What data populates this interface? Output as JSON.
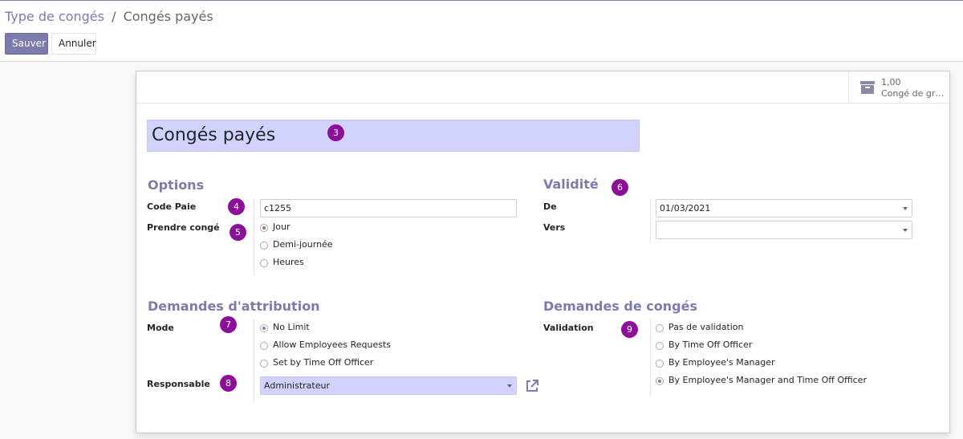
{
  "breadcrumb": {
    "parent": "Type de congés",
    "separator": "/",
    "current": "Congés payés"
  },
  "actions": {
    "save": "Sauver",
    "discard": "Annuler"
  },
  "stat_button": {
    "value": "1,00",
    "label": "Congé de gr…",
    "icon": "archive-icon"
  },
  "record": {
    "name": "Congés payés"
  },
  "options": {
    "title": "Options",
    "code_label": "Code Paie",
    "code_value": "c1255",
    "take_label": "Prendre congé",
    "take_choices": [
      "Jour",
      "Demi-journée",
      "Heures"
    ],
    "take_selected": "Jour"
  },
  "validity": {
    "title": "Validité",
    "from_label": "De",
    "from_value": "01/03/2021",
    "to_label": "Vers",
    "to_value": ""
  },
  "allocation": {
    "title": "Demandes d'attribution",
    "mode_label": "Mode",
    "mode_choices": [
      "No Limit",
      "Allow Employees Requests",
      "Set by Time Off Officer"
    ],
    "mode_selected": "No Limit",
    "responsible_label": "Responsable",
    "responsible_value": "Administrateur"
  },
  "leave_requests": {
    "title": "Demandes de congés",
    "validation_label": "Validation",
    "validation_choices": [
      "Pas de validation",
      "By Time Off Officer",
      "By Employee's Manager",
      "By Employee's Manager and Time Off Officer"
    ],
    "validation_selected": "By Employee's Manager and Time Off Officer"
  },
  "badges": [
    "3",
    "4",
    "5",
    "6",
    "7",
    "8",
    "9"
  ],
  "colors": {
    "brand": "#7c7bad",
    "required_field": "#d2d2ff",
    "badge": "#8b0f99"
  }
}
